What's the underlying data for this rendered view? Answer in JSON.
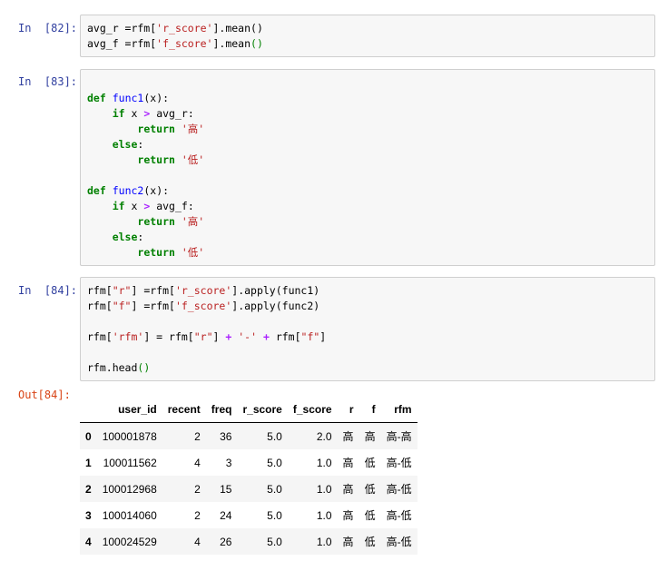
{
  "cells": [
    {
      "prompt": "In  [82]:",
      "lines": [
        [
          [
            "",
            "avg_r =rfm["
          ],
          [
            "str",
            "'r_score'"
          ],
          [
            "",
            "].mean()"
          ]
        ],
        [
          [
            "",
            "avg_f =rfm["
          ],
          [
            "str",
            "'f_score'"
          ],
          [
            "",
            "].mean"
          ],
          [
            "num",
            "()"
          ]
        ]
      ]
    },
    {
      "prompt": "In  [83]:",
      "lines": [
        [],
        [
          [
            "kw",
            "def"
          ],
          [
            "",
            " "
          ],
          [
            "fn",
            "func1"
          ],
          [
            "",
            "(x):"
          ]
        ],
        [
          [
            "",
            "    "
          ],
          [
            "kw",
            "if"
          ],
          [
            "",
            " x "
          ],
          [
            "op",
            ">"
          ],
          [
            "",
            " avg_r:"
          ]
        ],
        [
          [
            "",
            "        "
          ],
          [
            "kw",
            "return"
          ],
          [
            "",
            " "
          ],
          [
            "str",
            "'高'"
          ]
        ],
        [
          [
            "",
            "    "
          ],
          [
            "kw",
            "else"
          ],
          [
            "",
            ":"
          ]
        ],
        [
          [
            "",
            "        "
          ],
          [
            "kw",
            "return"
          ],
          [
            "",
            " "
          ],
          [
            "str",
            "'低'"
          ]
        ],
        [],
        [
          [
            "kw",
            "def"
          ],
          [
            "",
            " "
          ],
          [
            "fn",
            "func2"
          ],
          [
            "",
            "(x):"
          ]
        ],
        [
          [
            "",
            "    "
          ],
          [
            "kw",
            "if"
          ],
          [
            "",
            " x "
          ],
          [
            "op",
            ">"
          ],
          [
            "",
            " avg_f:"
          ]
        ],
        [
          [
            "",
            "        "
          ],
          [
            "kw",
            "return"
          ],
          [
            "",
            " "
          ],
          [
            "str",
            "'高'"
          ]
        ],
        [
          [
            "",
            "    "
          ],
          [
            "kw",
            "else"
          ],
          [
            "",
            ":"
          ]
        ],
        [
          [
            "",
            "        "
          ],
          [
            "kw",
            "return"
          ],
          [
            "",
            " "
          ],
          [
            "str",
            "'低'"
          ]
        ]
      ]
    },
    {
      "prompt": "In  [84]:",
      "lines": [
        [
          [
            "",
            "rfm["
          ],
          [
            "str",
            "\"r\""
          ],
          [
            "",
            "] =rfm["
          ],
          [
            "str",
            "'r_score'"
          ],
          [
            "",
            "].apply(func1)"
          ]
        ],
        [
          [
            "",
            "rfm["
          ],
          [
            "str",
            "\"f\""
          ],
          [
            "",
            "] =rfm["
          ],
          [
            "str",
            "'f_score'"
          ],
          [
            "",
            "].apply(func2)"
          ]
        ],
        [],
        [
          [
            "",
            "rfm["
          ],
          [
            "str",
            "'rfm'"
          ],
          [
            "",
            "] = rfm["
          ],
          [
            "str",
            "\"r\""
          ],
          [
            "",
            "] "
          ],
          [
            "op",
            "+"
          ],
          [
            "",
            " "
          ],
          [
            "str",
            "'-'"
          ],
          [
            "",
            " "
          ],
          [
            "op",
            "+"
          ],
          [
            "",
            " rfm["
          ],
          [
            "str",
            "\"f\""
          ],
          [
            "",
            "]"
          ]
        ],
        [],
        [
          [
            "",
            "rfm.head"
          ],
          [
            "num",
            "()"
          ]
        ]
      ]
    }
  ],
  "output": {
    "prompt": "Out[84]:",
    "columns": [
      "",
      "user_id",
      "recent",
      "freq",
      "r_score",
      "f_score",
      "r",
      "f",
      "rfm"
    ],
    "rows": [
      [
        "0",
        "100001878",
        "2",
        "36",
        "5.0",
        "2.0",
        "高",
        "高",
        "高-高"
      ],
      [
        "1",
        "100011562",
        "4",
        "3",
        "5.0",
        "1.0",
        "高",
        "低",
        "高-低"
      ],
      [
        "2",
        "100012968",
        "2",
        "15",
        "5.0",
        "1.0",
        "高",
        "低",
        "高-低"
      ],
      [
        "3",
        "100014060",
        "2",
        "24",
        "5.0",
        "1.0",
        "高",
        "低",
        "高-低"
      ],
      [
        "4",
        "100024529",
        "4",
        "26",
        "5.0",
        "1.0",
        "高",
        "低",
        "高-低"
      ]
    ]
  },
  "colors": {
    "in_prompt": "#303f9f",
    "out_prompt": "#d84315",
    "keyword": "#008000",
    "function_name": "#0000ff",
    "string": "#ba2121",
    "operator": "#aa22ff"
  }
}
